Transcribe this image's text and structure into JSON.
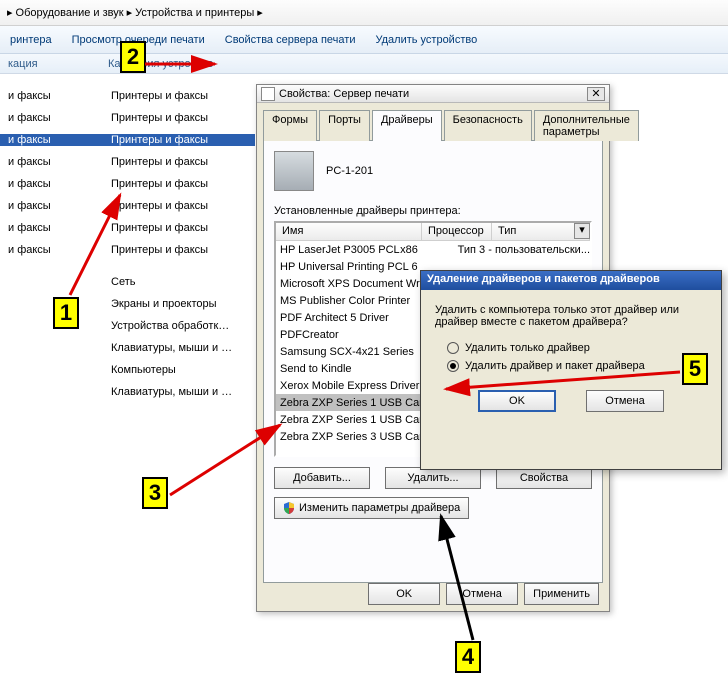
{
  "breadcrumb": {
    "seg1": "Оборудование и звук",
    "seg2": "Устройства и принтеры"
  },
  "toolbar": {
    "item1": "ринтера",
    "item2": "Просмотр очереди печати",
    "item3": "Свойства сервера печати",
    "item4": "Удалить устройство"
  },
  "category_strip": {
    "c1": "кация",
    "c2": "Категория устройств"
  },
  "device_rows": [
    {
      "c1": "и факсы",
      "c2": "Принтеры и факсы",
      "sel": false
    },
    {
      "c1": "и факсы",
      "c2": "Принтеры и факсы",
      "sel": false
    },
    {
      "c1": "и факсы",
      "c2": "Принтеры и факсы",
      "sel": true
    },
    {
      "c1": "и факсы",
      "c2": "Принтеры и факсы",
      "sel": false
    },
    {
      "c1": "и факсы",
      "c2": "Принтеры и факсы",
      "sel": false
    },
    {
      "c1": "и факсы",
      "c2": "Принтеры и факсы",
      "sel": false
    },
    {
      "c1": "и факсы",
      "c2": "Принтеры и факсы",
      "sel": false
    },
    {
      "c1": "и факсы",
      "c2": "Принтеры и факсы",
      "sel": false
    }
  ],
  "other_rows": [
    "Сеть",
    "Экраны и проекторы",
    "Устройства обработк…",
    "Клавиатуры, мыши и …",
    "Компьютеры",
    "Клавиатуры, мыши и …"
  ],
  "dlg": {
    "title": "Свойства: Сервер печати",
    "tabs": [
      "Формы",
      "Порты",
      "Драйверы",
      "Безопасность",
      "Дополнительные параметры"
    ],
    "active_tab": 2,
    "server_name": "PC-1-201",
    "installed_label": "Установленные драйверы принтера:",
    "cols": {
      "name": "Имя",
      "proc": "Процессор",
      "type": "Тип"
    },
    "drivers": [
      {
        "name": "HP LaserJet P3005 PCL6",
        "proc": "x86",
        "type": "Тип 3 - пользовательски...",
        "sel": false
      },
      {
        "name": "HP Universal Printing PCL 6",
        "sel": false
      },
      {
        "name": "Microsoft XPS Document Writer",
        "sel": false
      },
      {
        "name": "MS Publisher Color Printer",
        "sel": false
      },
      {
        "name": "PDF Architect 5 Driver",
        "sel": false
      },
      {
        "name": "PDFCreator",
        "sel": false
      },
      {
        "name": "Samsung SCX-4x21 Series",
        "sel": false
      },
      {
        "name": "Send to Kindle",
        "sel": false
      },
      {
        "name": "Xerox Mobile Express Driver",
        "sel": false
      },
      {
        "name": "Zebra ZXP Series 1 USB Card Printer",
        "sel": true
      },
      {
        "name": "Zebra ZXP Series 1 USB Card Printer",
        "sel": false
      },
      {
        "name": "Zebra ZXP Series 3 USB Card Printer",
        "sel": false
      }
    ],
    "btn_add": "Добавить...",
    "btn_remove": "Удалить...",
    "btn_props": "Свойства",
    "btn_change": "Изменить параметры драйвера",
    "ok": "OK",
    "cancel": "Отмена",
    "apply": "Применить"
  },
  "subdlg": {
    "title": "Удаление драйверов и пакетов драйверов",
    "question": "Удалить с компьютера только этот драйвер или драйвер вместе с пакетом драйвера?",
    "opt1": "Удалить только драйвер",
    "opt2": "Удалить драйвер и пакет драйвера",
    "selected": 2,
    "ok": "OK",
    "cancel": "Отмена"
  },
  "callouts": {
    "1": "1",
    "2": "2",
    "3": "3",
    "4": "4",
    "5": "5"
  }
}
